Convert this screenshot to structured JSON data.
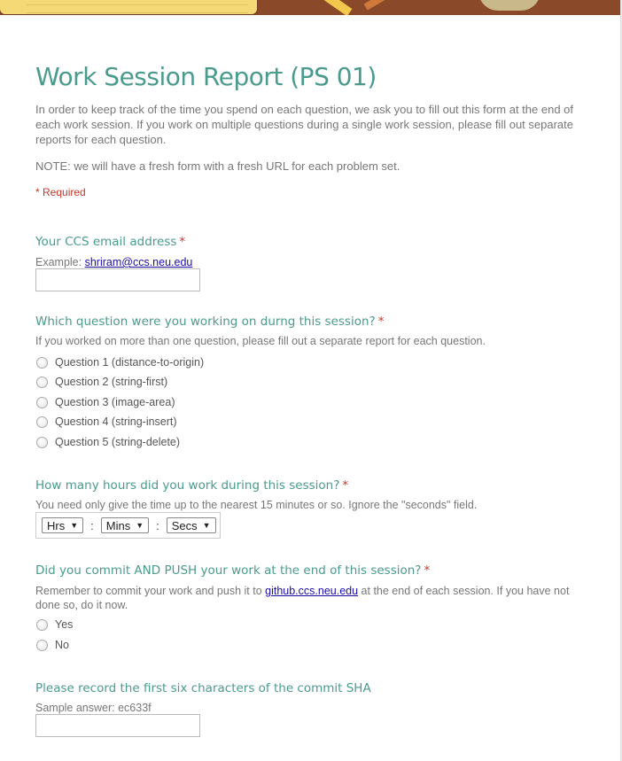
{
  "form": {
    "title": "Work Session Report (PS 01)",
    "description": "In order to keep track of the time you spend on each question, we ask you to fill out this form at the end of each work session.  If you work on multiple questions during a single work session, please fill out separate reports for each question.",
    "note": "NOTE: we will have a fresh form with a fresh URL for each problem set.",
    "required_note": "* Required"
  },
  "questions": {
    "email": {
      "title": "Your CCS email address",
      "required_mark": "*",
      "help_prefix": "Example: ",
      "help_link": "shriram@ccs.neu.edu",
      "value": ""
    },
    "question_choice": {
      "title": "Which question were you working on durng this session?",
      "required_mark": "*",
      "help": "If you worked on more than one question, please fill out a separate report for each question.",
      "options": [
        "Question 1 (distance-to-origin)",
        "Question 2 (string-first)",
        "Question 3 (image-area)",
        "Question 4 (string-insert)",
        "Question 5 (string-delete)"
      ]
    },
    "hours": {
      "title": "How many hours did you work during this session?",
      "required_mark": "*",
      "help": "You need only give the time up to the nearest 15 minutes or so. Ignore the \"seconds\" field.",
      "hrs_label": "Hrs",
      "mins_label": "Mins",
      "secs_label": "Secs",
      "separator": ":"
    },
    "commit": {
      "title": "Did you commit AND PUSH your work at the end of this session?",
      "required_mark": "*",
      "help_prefix": "Remember to commit your work and push it to ",
      "help_link": "github.ccs.neu.edu",
      "help_suffix": " at the end of each session. If you have not done so, do it now.",
      "options": [
        "Yes",
        "No"
      ]
    },
    "sha": {
      "title": "Please record the first six characters of the commit SHA",
      "help": "Sample answer: ec633f",
      "value": ""
    }
  },
  "colors": {
    "accent": "#4a9b8e",
    "required": "#c0392b",
    "link": "#1a0dab"
  }
}
